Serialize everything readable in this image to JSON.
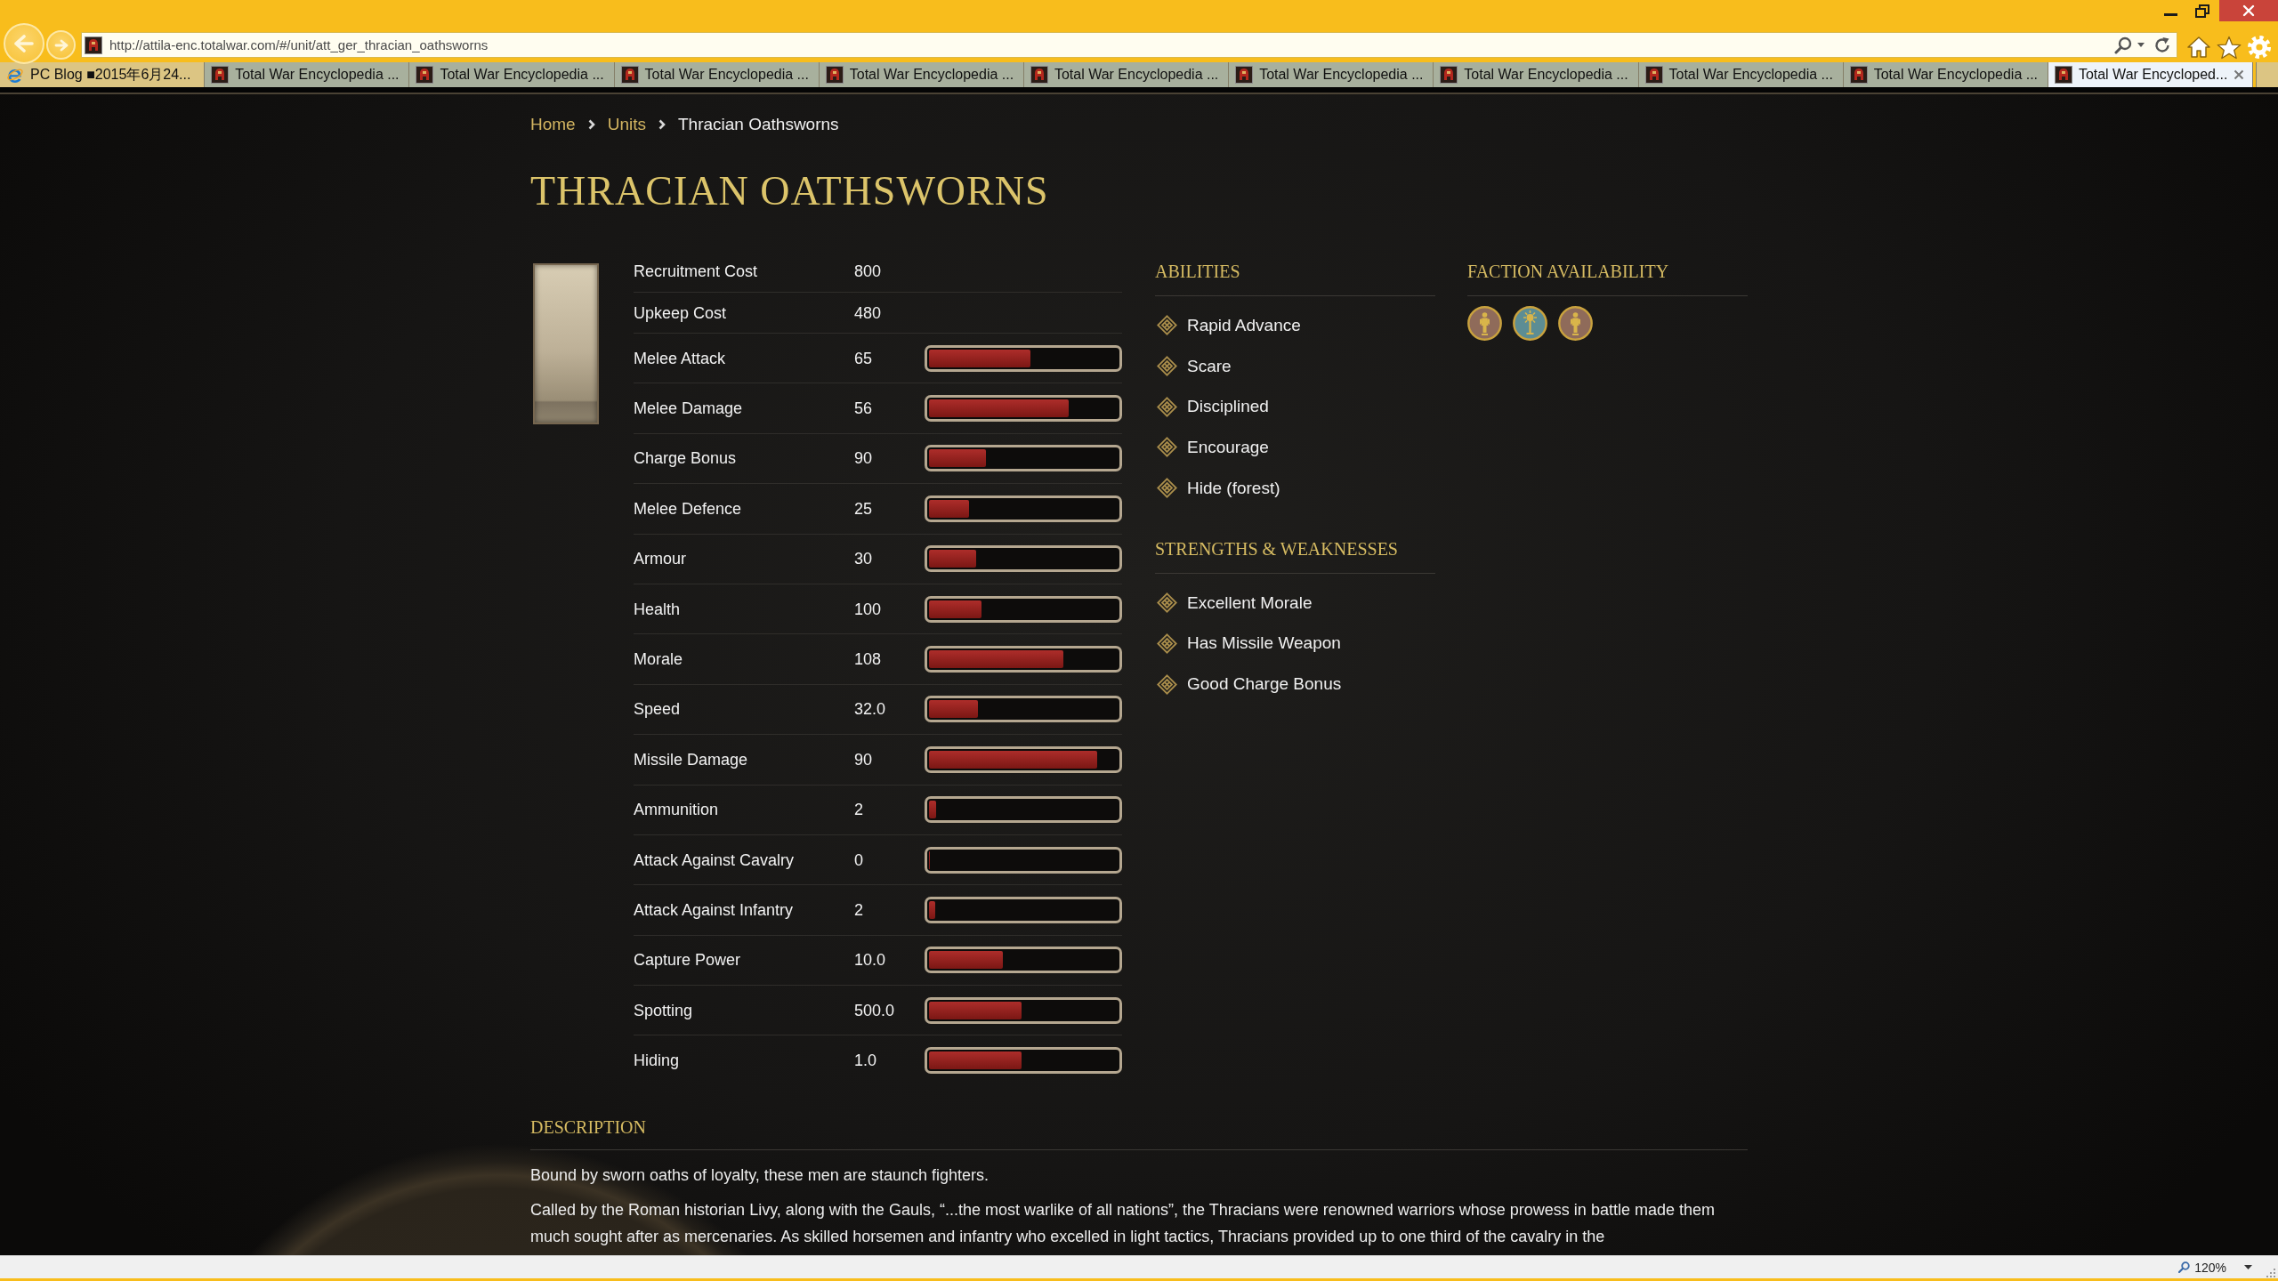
{
  "browser": {
    "address_bar": {
      "url": "http://attila-enc.totalwar.com/#/unit/att_ger_thracian_oathsworns"
    },
    "tabs": [
      {
        "label": "PC Blog ■2015年6月24...",
        "kind": "blog",
        "selected": false
      },
      {
        "label": "Total War Encyclopedia ...",
        "kind": "site",
        "selected": false
      },
      {
        "label": "Total War Encyclopedia ...",
        "kind": "site",
        "selected": false
      },
      {
        "label": "Total War Encyclopedia ...",
        "kind": "site",
        "selected": false
      },
      {
        "label": "Total War Encyclopedia ...",
        "kind": "site",
        "selected": false
      },
      {
        "label": "Total War Encyclopedia ...",
        "kind": "site",
        "selected": false
      },
      {
        "label": "Total War Encyclopedia ...",
        "kind": "site",
        "selected": false
      },
      {
        "label": "Total War Encyclopedia ...",
        "kind": "site",
        "selected": false
      },
      {
        "label": "Total War Encyclopedia ...",
        "kind": "site",
        "selected": false
      },
      {
        "label": "Total War Encyclopedia ...",
        "kind": "site",
        "selected": false
      },
      {
        "label": "Total War Encycloped...",
        "kind": "site",
        "selected": true
      }
    ]
  },
  "breadcrumb": [
    {
      "label": "Home",
      "kind": "link"
    },
    {
      "label": "Units",
      "kind": "link"
    },
    {
      "label": "Thracian Oathsworns",
      "kind": "current"
    }
  ],
  "title": "THRACIAN OATHSWORNS",
  "stats": [
    {
      "name": "Recruitment Cost",
      "value": "800"
    },
    {
      "name": "Upkeep Cost",
      "value": "480"
    },
    {
      "name": "Melee Attack",
      "value": "65",
      "level": 0.54
    },
    {
      "name": "Melee Damage",
      "value": "56",
      "level": 0.74
    },
    {
      "name": "Charge Bonus",
      "value": "90",
      "level": 0.3
    },
    {
      "name": "Melee Defence",
      "value": "25",
      "level": 0.21
    },
    {
      "name": "Armour",
      "value": "30",
      "level": 0.25
    },
    {
      "name": "Health",
      "value": "100",
      "level": 0.28
    },
    {
      "name": "Morale",
      "value": "108",
      "level": 0.71
    },
    {
      "name": "Speed",
      "value": "32.0",
      "level": 0.26
    },
    {
      "name": "Missile Damage",
      "value": "90",
      "level": 0.89
    },
    {
      "name": "Ammunition",
      "value": "2",
      "level": 0.04
    },
    {
      "name": "Attack Against Cavalry",
      "value": "0",
      "level": 0
    },
    {
      "name": "Attack Against Infantry",
      "value": "2",
      "level": 0.035
    },
    {
      "name": "Capture Power",
      "value": "10.0",
      "level": 0.39
    },
    {
      "name": "Spotting",
      "value": "500.0",
      "level": 0.49
    },
    {
      "name": "Hiding",
      "value": "1.0",
      "level": 0.49
    }
  ],
  "abilities": {
    "heading": "ABILITIES",
    "items": [
      "Rapid Advance",
      "Scare",
      "Disciplined",
      "Encourage",
      "Hide (forest)"
    ]
  },
  "faction_availability": {
    "heading": "FACTION AVAILABILITY",
    "factions": [
      {
        "kind": "figure",
        "color": "#8f6b5a"
      },
      {
        "kind": "sun",
        "color": "#5c8d94"
      },
      {
        "kind": "figure",
        "color": "#8f6b5a"
      }
    ]
  },
  "strengths_weaknesses": {
    "heading": "STRENGTHS & WEAKNESSES",
    "items": [
      "Excellent Morale",
      "Has Missile Weapon",
      "Good Charge Bonus"
    ]
  },
  "description": {
    "heading": "DESCRIPTION",
    "paragraphs": [
      "Bound by sworn oaths of loyalty, these men are staunch fighters.",
      "Called by the Roman historian Livy, along with the Gauls, “...the most warlike of all nations”, the Thracians were renowned warriors whose prowess in battle made them much sought after as mercenaries. As skilled horsemen and infantry who excelled in light tactics, Thracians provided up to one third of the cavalry in the"
    ]
  },
  "status_bar": {
    "zoom": "120%"
  }
}
